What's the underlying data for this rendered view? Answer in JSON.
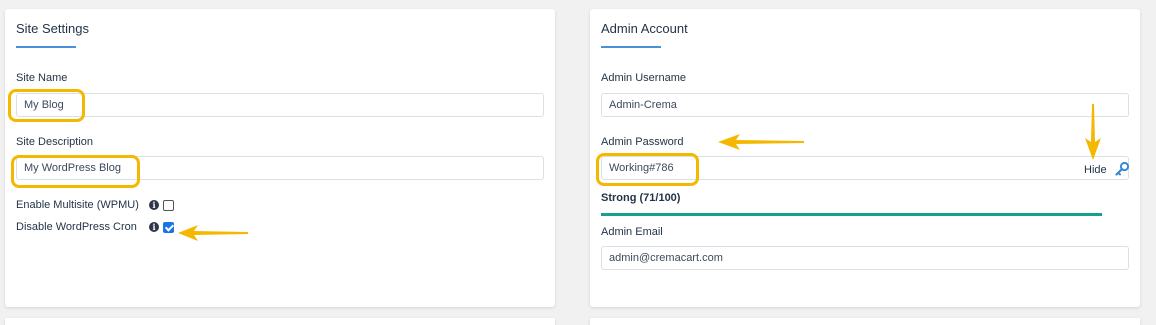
{
  "site_settings": {
    "title": "Site Settings",
    "site_name_label": "Site Name",
    "site_name_value": "My Blog",
    "site_description_label": "Site Description",
    "site_description_value": "My WordPress Blog",
    "multisite_label": "Enable Multisite (WPMU)",
    "multisite_checked": false,
    "cron_label": "Disable WordPress Cron",
    "cron_checked": true
  },
  "admin_account": {
    "title": "Admin Account",
    "username_label": "Admin Username",
    "username_value": "Admin-Crema",
    "password_label": "Admin Password",
    "password_value": "Working#786",
    "hide_label": "Hide",
    "strength_text": "Strong (71/100)",
    "strength_fraction": 0.71,
    "email_label": "Admin Email",
    "email_value": "admin@cremacart.com"
  },
  "icons": {
    "info": "info-icon",
    "key": "key-icon",
    "arrow": "arrow-icon"
  },
  "colors": {
    "highlight": "#f5b800",
    "accent_underline": "#4a90d9",
    "checkbox_checked": "#1a73e8",
    "strength_good": "#1a9e8f"
  }
}
